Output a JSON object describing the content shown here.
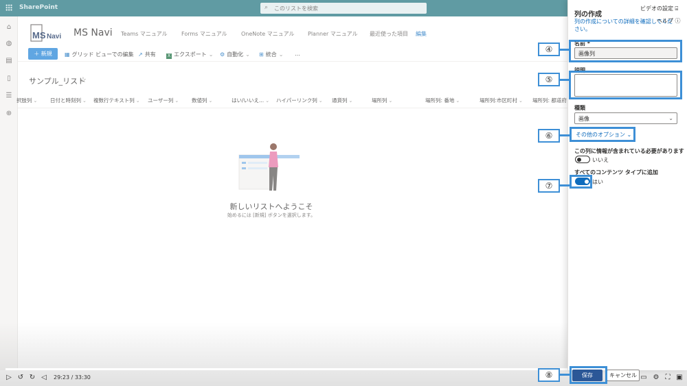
{
  "topbar": {
    "app_name": "SharePoint",
    "search_placeholder": "このリストを検索",
    "search_icon": "search-icon"
  },
  "left_rail": {
    "icons": [
      "home-icon",
      "globe-icon",
      "news-icon",
      "document-icon",
      "database-icon",
      "add-circle-icon"
    ]
  },
  "site": {
    "name": "MS Navi",
    "logo_text": "MSNavi",
    "nav": [
      "Teams マニュアル",
      "Forms マニュアル",
      "OneNote マニュアル",
      "Planner マニュアル",
      "最近使った項目"
    ],
    "nav_edit": "編集"
  },
  "command_bar": {
    "new_label": "新規",
    "grid_view": "グリッド ビューでの編集",
    "share": "共有",
    "export": "エクスポート",
    "automate": "自動化",
    "integrate": "統合",
    "more": "…"
  },
  "list": {
    "title": "サンプル_リスト",
    "columns": [
      "択肢列",
      "日付と時刻列",
      "複数行テキスト列",
      "ユーザー列",
      "数値列",
      "はい/いいえ...",
      "ハイパーリンク列",
      "通貨列",
      "場所列",
      "場所列: 番地",
      "場所列:市区町村",
      "場所列: 都道府"
    ],
    "empty_title": "新しいリストへようこそ",
    "empty_subtitle": "始めるには [新規] ボタンを選択します。"
  },
  "panel": {
    "title": "列の作成",
    "info_link": "列の作成についての詳細を確認してください。",
    "video_settings": "ビデオの設定",
    "help": "ヘルプ",
    "name_label": "名前 *",
    "name_value": "画像列",
    "description_label": "説明",
    "description_value": "",
    "type_label": "種類",
    "type_value": "画像",
    "more_options": "その他のオプション",
    "required_label": "この列に情報が含まれている必要があります",
    "required_value": "いいえ",
    "add_all_label": "すべてのコンテンツ タイプに追加",
    "add_all_value": "はい",
    "save": "保存",
    "cancel": "キャンセル"
  },
  "player": {
    "time": "29:23 / 33:30",
    "progress": 0.877,
    "accent": "#ffffff"
  },
  "callouts": [
    "④",
    "⑤",
    "⑥",
    "⑦",
    "⑧"
  ],
  "colors": {
    "topbar": "#2b7a84",
    "accent": "#0f6cbd",
    "callout": "#3d8fd6"
  }
}
